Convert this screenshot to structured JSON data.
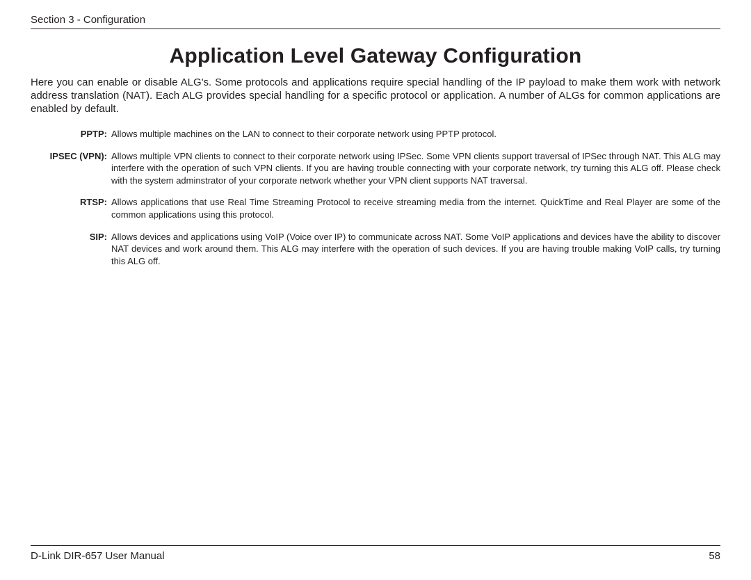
{
  "header": {
    "section_label": "Section 3 - Configuration"
  },
  "title": "Application Level Gateway Configuration",
  "intro": "Here you can enable or disable ALG's. Some protocols and applications require special handling of the IP payload to make them work with network address translation (NAT). Each ALG provides special handling for a specific protocol or application. A number of ALGs for common applications are enabled by default.",
  "definitions": [
    {
      "term": "PPTP:",
      "desc": "Allows multiple machines on the LAN to connect to their corporate network using PPTP protocol."
    },
    {
      "term": "IPSEC (VPN):",
      "desc": "Allows multiple VPN clients to connect to their corporate network using IPSec. Some VPN clients support traversal of IPSec through NAT. This ALG may interfere with the operation of such VPN clients. If you are having trouble connecting with your corporate network, try turning this ALG off. Please check with the system adminstrator of your corporate network whether your VPN client supports NAT traversal."
    },
    {
      "term": "RTSP:",
      "desc": "Allows applications that use Real Time Streaming Protocol to receive streaming media from the internet. QuickTime and Real Player are some of the common applications using this protocol."
    },
    {
      "term": "SIP:",
      "desc": "Allows devices and applications using VoIP (Voice over IP) to communicate across NAT. Some VoIP applications and devices have the ability to discover NAT devices and work around them. This ALG may interfere with the operation of such devices. If you are having trouble making VoIP calls, try turning this ALG off."
    }
  ],
  "footer": {
    "manual_label": "D-Link DIR-657 User Manual",
    "page_number": "58"
  }
}
